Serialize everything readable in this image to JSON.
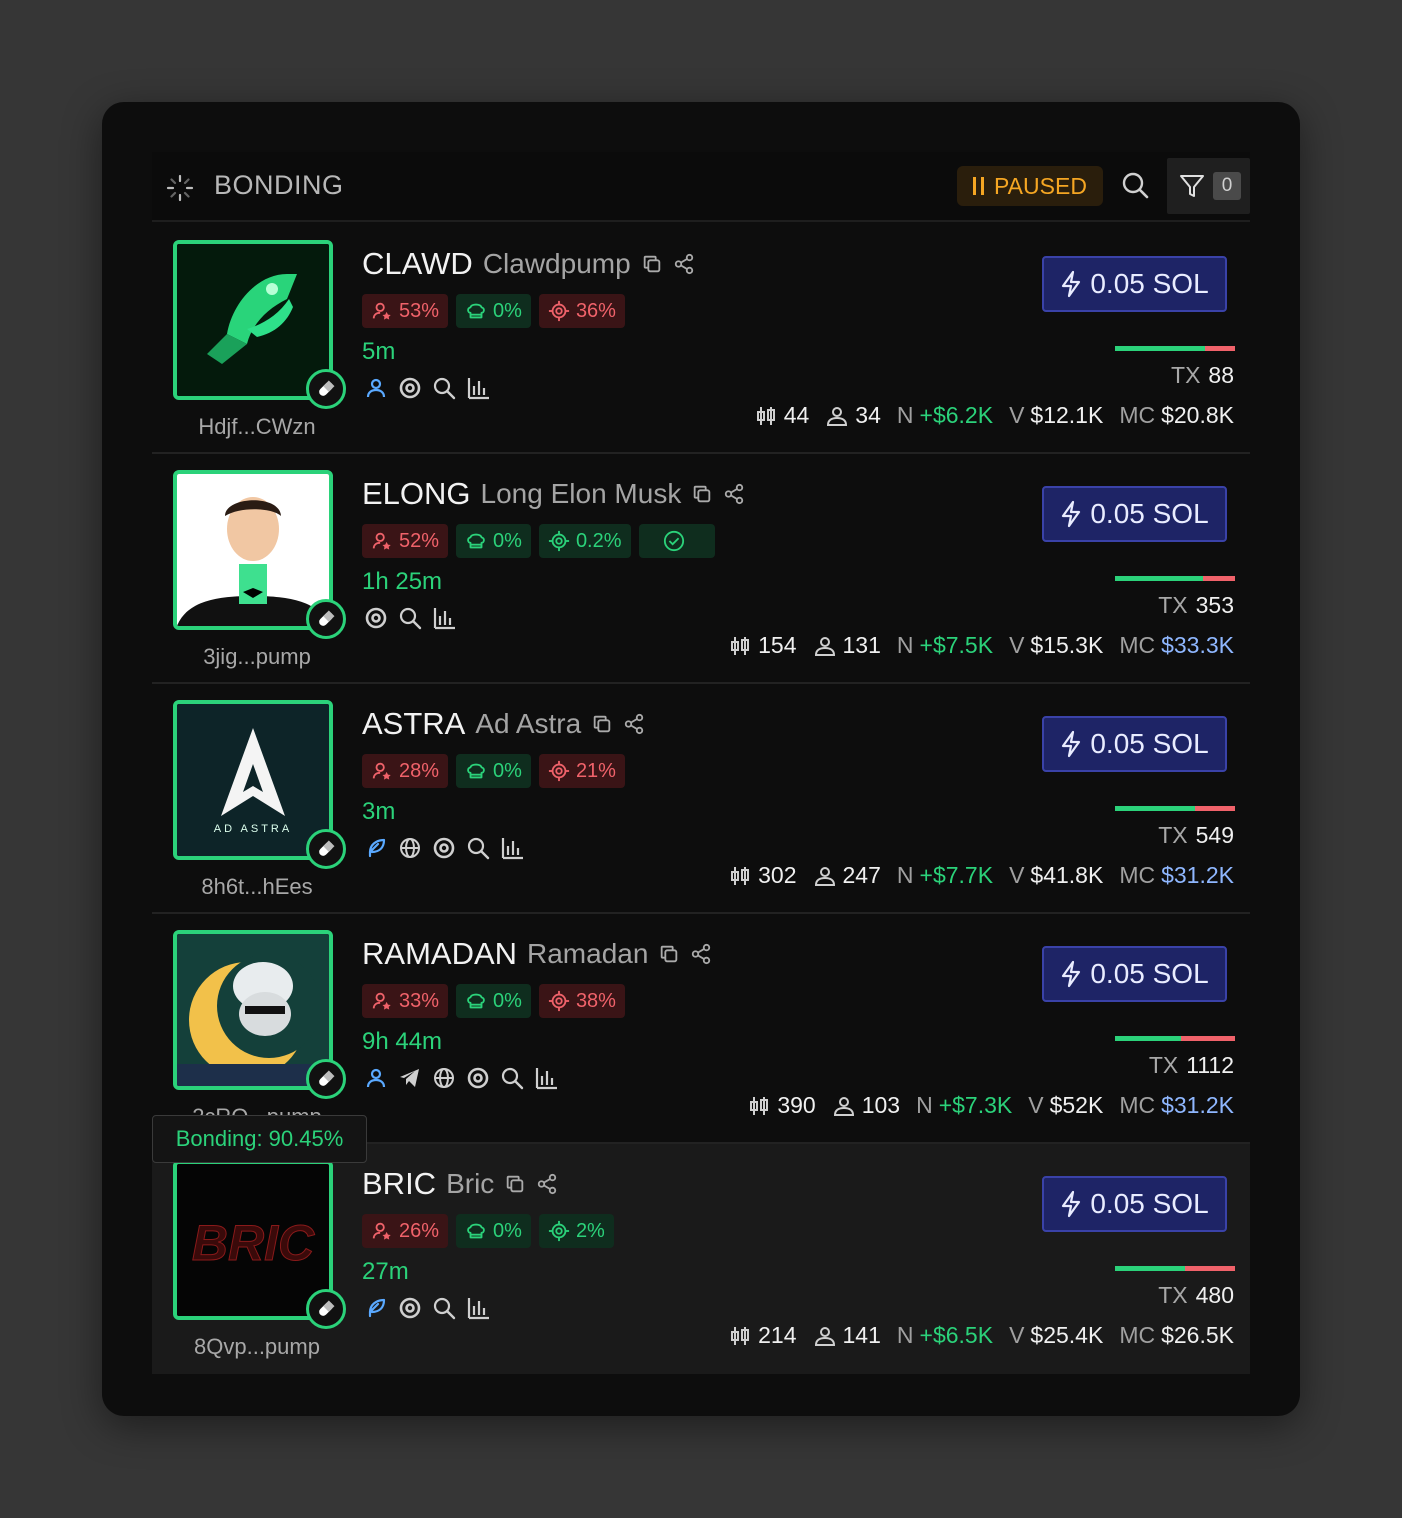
{
  "header": {
    "title": "BONDING",
    "paused_label": "PAUSED",
    "filter_count": "0"
  },
  "tooltip": {
    "text": "Bonding: 90.45%"
  },
  "colors": {
    "accent_green": "#2bd27a",
    "accent_red": "#f0626a",
    "paused_orange": "#f5a623",
    "buy_blue": "#1e2466"
  },
  "tokens": [
    {
      "ticker": "CLAWD",
      "name": "Clawdpump",
      "address": "Hdjf...CWzn",
      "badges": [
        {
          "kind": "red",
          "icon": "top-holders-icon",
          "value": "53%"
        },
        {
          "kind": "green",
          "icon": "dev-hat-icon",
          "value": "0%"
        },
        {
          "kind": "red",
          "icon": "target-icon",
          "value": "36%"
        }
      ],
      "age": "5m",
      "socials": [
        "user-icon",
        "at-icon",
        "search-icon",
        "chart-icon"
      ],
      "buy_label": "0.05 SOL",
      "progress": 0.75,
      "tx_label": "TX",
      "tx": "88",
      "holders_a": "44",
      "holders_b": "34",
      "n_label": "N",
      "n": "+$6.2K",
      "v_label": "V",
      "v": "$12.1K",
      "mc_label": "MC",
      "mc": "$20.8K",
      "mc_color": "white"
    },
    {
      "ticker": "ELONG",
      "name": "Long Elon Musk",
      "address": "3jig...pump",
      "badges": [
        {
          "kind": "red",
          "icon": "top-holders-icon",
          "value": "52%"
        },
        {
          "kind": "green",
          "icon": "dev-hat-icon",
          "value": "0%"
        },
        {
          "kind": "green",
          "icon": "target-icon",
          "value": "0.2%"
        },
        {
          "kind": "green",
          "icon": "verified-icon",
          "value": ""
        }
      ],
      "age": "1h 25m",
      "socials": [
        "at-icon",
        "search-icon",
        "chart-icon"
      ],
      "buy_label": "0.05 SOL",
      "progress": 0.73,
      "tx_label": "TX",
      "tx": "353",
      "holders_a": "154",
      "holders_b": "131",
      "n_label": "N",
      "n": "+$7.5K",
      "v_label": "V",
      "v": "$15.3K",
      "mc_label": "MC",
      "mc": "$33.3K",
      "mc_color": "blue"
    },
    {
      "ticker": "ASTRA",
      "name": "Ad Astra",
      "address": "8h6t...hEes",
      "badges": [
        {
          "kind": "red",
          "icon": "top-holders-icon",
          "value": "28%"
        },
        {
          "kind": "green",
          "icon": "dev-hat-icon",
          "value": "0%"
        },
        {
          "kind": "red",
          "icon": "target-icon",
          "value": "21%"
        }
      ],
      "age": "3m",
      "socials": [
        "feather-icon",
        "globe-icon",
        "at-icon",
        "search-icon",
        "chart-icon"
      ],
      "buy_label": "0.05 SOL",
      "progress": 0.67,
      "tx_label": "TX",
      "tx": "549",
      "holders_a": "302",
      "holders_b": "247",
      "n_label": "N",
      "n": "+$7.7K",
      "v_label": "V",
      "v": "$41.8K",
      "mc_label": "MC",
      "mc": "$31.2K",
      "mc_color": "blue"
    },
    {
      "ticker": "RAMADAN",
      "name": "Ramadan",
      "address": "2cRQ...pump",
      "badges": [
        {
          "kind": "red",
          "icon": "top-holders-icon",
          "value": "33%"
        },
        {
          "kind": "green",
          "icon": "dev-hat-icon",
          "value": "0%"
        },
        {
          "kind": "red",
          "icon": "target-icon",
          "value": "38%"
        }
      ],
      "age": "9h 44m",
      "socials": [
        "user-icon",
        "telegram-icon",
        "globe-icon",
        "at-icon",
        "search-icon",
        "chart-icon"
      ],
      "buy_label": "0.05 SOL",
      "progress": 0.55,
      "tx_label": "TX",
      "tx": "1112",
      "holders_a": "390",
      "holders_b": "103",
      "n_label": "N",
      "n": "+$7.3K",
      "v_label": "V",
      "v": "$52K",
      "mc_label": "MC",
      "mc": "$31.2K",
      "mc_color": "blue"
    },
    {
      "ticker": "BRIC",
      "name": "Bric",
      "address": "8Qvp...pump",
      "badges": [
        {
          "kind": "red",
          "icon": "top-holders-icon",
          "value": "26%"
        },
        {
          "kind": "green",
          "icon": "dev-hat-icon",
          "value": "0%"
        },
        {
          "kind": "green",
          "icon": "target-icon",
          "value": "2%"
        }
      ],
      "age": "27m",
      "socials": [
        "feather-icon",
        "at-icon",
        "search-icon",
        "chart-icon"
      ],
      "buy_label": "0.05 SOL",
      "progress": 0.58,
      "tx_label": "TX",
      "tx": "480",
      "holders_a": "214",
      "holders_b": "141",
      "n_label": "N",
      "n": "+$6.5K",
      "v_label": "V",
      "v": "$25.4K",
      "mc_label": "MC",
      "mc": "$26.5K",
      "mc_color": "white"
    }
  ]
}
